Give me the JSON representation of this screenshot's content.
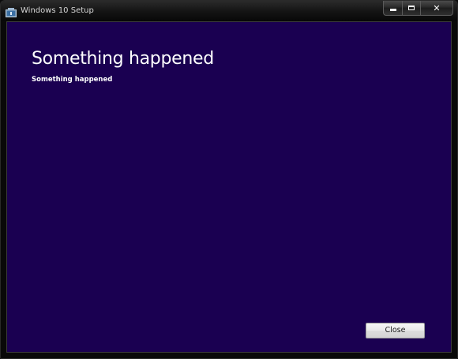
{
  "window": {
    "title": "Windows 10 Setup",
    "icon": "setup-app-icon",
    "caption_buttons": {
      "minimize_icon": "minimize-icon",
      "maximize_icon": "maximize-icon",
      "close_glyph": "✕"
    }
  },
  "content": {
    "heading": "Something happened",
    "message": "Something happened"
  },
  "actions": {
    "close_label": "Close"
  },
  "colors": {
    "client_background": "#1a0051",
    "text": "#ffffff",
    "chrome": "#090909"
  }
}
